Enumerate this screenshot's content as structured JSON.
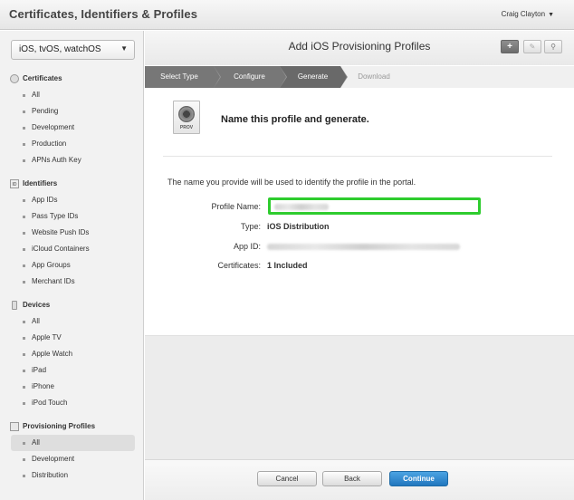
{
  "app": {
    "title": "Certificates, Identifiers & Profiles",
    "user": "Craig Clayton",
    "user_caret": "▼"
  },
  "sidebar": {
    "platform": "iOS, tvOS, watchOS",
    "platform_arrow": "▼",
    "sections": [
      {
        "title": "Certificates",
        "icon": "certificate-icon",
        "items": [
          "All",
          "Pending",
          "Development",
          "Production",
          "APNs Auth Key"
        ]
      },
      {
        "title": "Identifiers",
        "icon": "identifier-icon",
        "items": [
          "App IDs",
          "Pass Type IDs",
          "Website Push IDs",
          "iCloud Containers",
          "App Groups",
          "Merchant IDs"
        ]
      },
      {
        "title": "Devices",
        "icon": "device-icon",
        "items": [
          "All",
          "Apple TV",
          "Apple Watch",
          "iPad",
          "iPhone",
          "iPod Touch"
        ]
      },
      {
        "title": "Provisioning Profiles",
        "icon": "profile-icon",
        "items": [
          "All",
          "Development",
          "Distribution"
        ],
        "active_index": 0
      }
    ]
  },
  "header": {
    "title": "Add iOS Provisioning Profiles",
    "add_glyph": "+",
    "edit_glyph": "✎",
    "search_glyph": "⚲"
  },
  "steps": [
    "Select Type",
    "Configure",
    "Generate",
    "Download"
  ],
  "content": {
    "icon_label": "PROV",
    "title": "Name this profile and generate.",
    "intro": "The name you provide will be used to identify the profile in the portal.",
    "fields": {
      "profile_name_label": "Profile Name:",
      "type_label": "Type:",
      "type_value": "iOS Distribution",
      "app_id_label": "App ID:",
      "certificates_label": "Certificates:",
      "certificates_value": "1 Included"
    }
  },
  "footer": {
    "cancel": "Cancel",
    "back": "Back",
    "continue": "Continue"
  }
}
